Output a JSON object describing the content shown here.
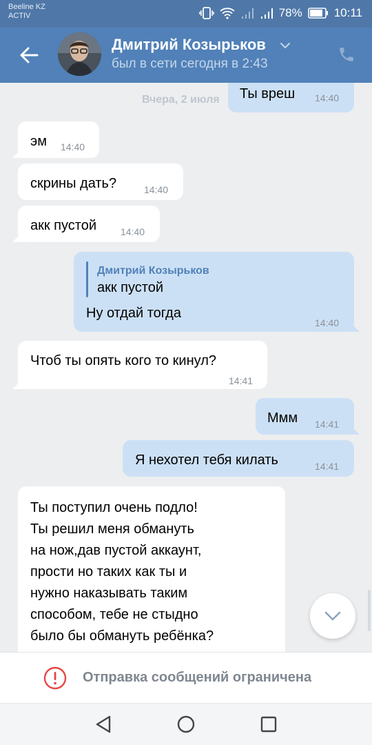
{
  "status_bar": {
    "carrier_line1": "Beeline KZ",
    "carrier_line2": "ACTIV",
    "battery": "78%",
    "time": "10:11"
  },
  "header": {
    "name": "Дмитрий Козырьков",
    "status": "был в сети сегодня в 2:43"
  },
  "chat": {
    "date_separator": "Вчера, 2 июля",
    "messages": [
      {
        "direction": "out",
        "text": "Ты вреш",
        "time": "14:40"
      },
      {
        "direction": "in",
        "text": "эм",
        "time": "14:40"
      },
      {
        "direction": "in",
        "text": "скрины дать?",
        "time": "14:40"
      },
      {
        "direction": "in",
        "text": "акк пустой",
        "time": "14:40"
      },
      {
        "direction": "out",
        "reply_author": "Дмитрий Козырьков",
        "reply_text": "акк пустой",
        "text": "Ну отдай тогда",
        "time": "14:40"
      },
      {
        "direction": "in",
        "text": "Чтоб ты опять кого то кинул?",
        "time": "14:41"
      },
      {
        "direction": "out",
        "text": "Ммм",
        "time": "14:41"
      },
      {
        "direction": "out",
        "text": "Я нехотел тебя килать",
        "time": "14:41"
      },
      {
        "direction": "in",
        "text": "Ты поступил очень подло!\nТы решил меня обмануть\nна нож,дав пустой аккаунт,\nпрости но таких как ты и\nнужно наказывать таким\nспособом, тебе не стыдно\nбыло бы обмануть ребёнка?"
      }
    ]
  },
  "restricted_bar": {
    "text": "Отправка сообщений ограничена"
  },
  "colors": {
    "header_bg": "#5181b8",
    "out_bubble": "#cce0f5",
    "in_bubble": "#ffffff",
    "chat_bg": "#edeef0",
    "warning_red": "#e64646"
  },
  "icons": [
    "back-arrow-icon",
    "chevron-down-icon",
    "phone-icon",
    "scroll-down-icon",
    "warning-icon",
    "nav-back-icon",
    "nav-home-icon",
    "nav-recents-icon"
  ]
}
